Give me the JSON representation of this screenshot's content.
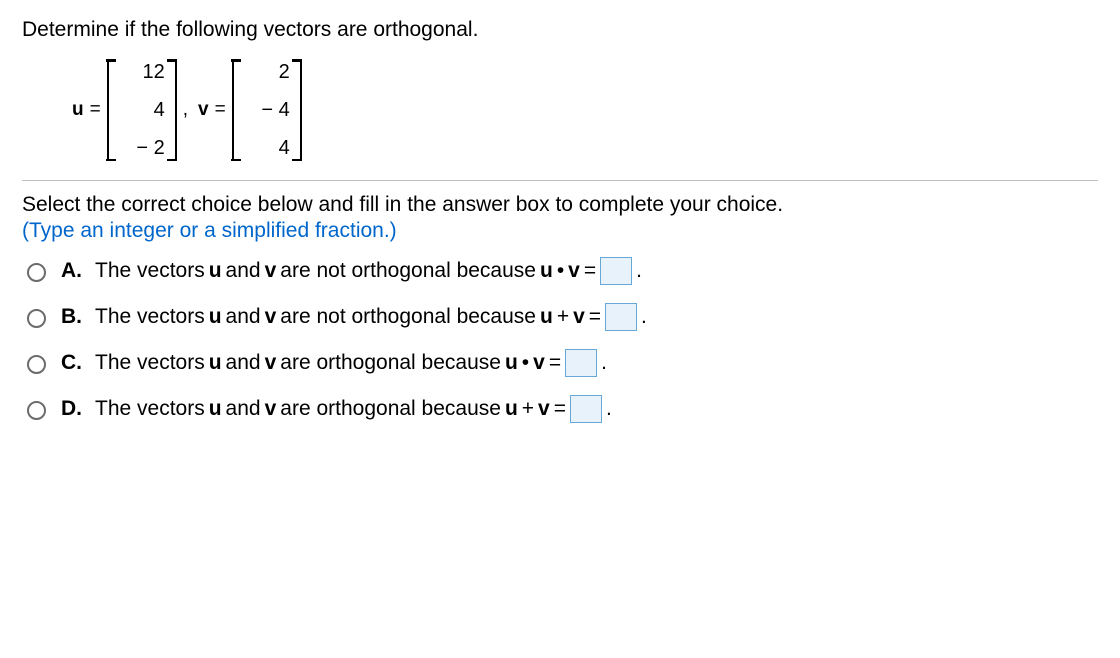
{
  "question": "Determine if the following vectors are orthogonal.",
  "vectors": {
    "u_label": "u",
    "v_label": "v",
    "eq": "=",
    "u": [
      "12",
      "4",
      "− 2"
    ],
    "v": [
      "2",
      "− 4",
      "4"
    ],
    "sep": ","
  },
  "instruction": "Select the correct choice below and fill in the answer box to complete your choice.",
  "hint": "(Type an integer or a simplified fraction.)",
  "choices": [
    {
      "letter": "A.",
      "pre": "The vectors ",
      "u": "u",
      "mid1": " and ",
      "v": "v",
      "mid2": " are not orthogonal because ",
      "expr_u": "u",
      "op": " • ",
      "expr_v": "v",
      "eq": " = ",
      "post": "."
    },
    {
      "letter": "B.",
      "pre": "The vectors ",
      "u": "u",
      "mid1": " and ",
      "v": "v",
      "mid2": " are not orthogonal because ",
      "expr_u": "u",
      "op": " + ",
      "expr_v": "v",
      "eq": " = ",
      "post": "."
    },
    {
      "letter": "C.",
      "pre": "The vectors ",
      "u": "u",
      "mid1": " and ",
      "v": "v",
      "mid2": " are orthogonal because ",
      "expr_u": "u",
      "op": " • ",
      "expr_v": "v",
      "eq": " = ",
      "post": "."
    },
    {
      "letter": "D.",
      "pre": "The vectors ",
      "u": "u",
      "mid1": " and ",
      "v": "v",
      "mid2": " are orthogonal because ",
      "expr_u": "u",
      "op": " + ",
      "expr_v": "v",
      "eq": " = ",
      "post": "."
    }
  ]
}
